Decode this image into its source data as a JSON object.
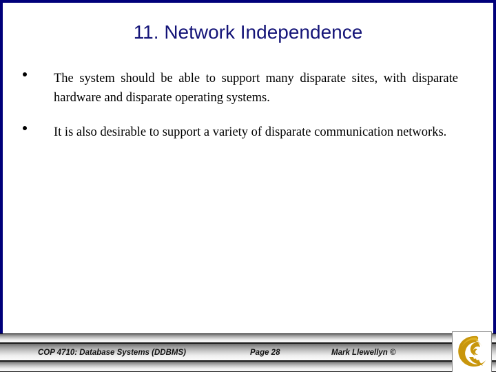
{
  "slide": {
    "title": "11. Network Independence",
    "title_color": "#141478",
    "frame_color": "#00007a",
    "background_color": "#ffffff",
    "bullets": [
      {
        "marker": "bullet-dot",
        "text": "The system should be able to support many disparate sites, with disparate hardware and disparate operating systems."
      },
      {
        "marker": "bullet-dot",
        "text": "It is also desirable to support a variety of disparate communication networks."
      }
    ]
  },
  "footer": {
    "course": "COP 4710: Database Systems  (DDBMS)",
    "page": "Page 28",
    "author": "Mark Llewellyn ©",
    "logo": {
      "name": "ucf-pegasus-logo",
      "color": "#c8960c",
      "highlight": "#e0b326"
    }
  }
}
